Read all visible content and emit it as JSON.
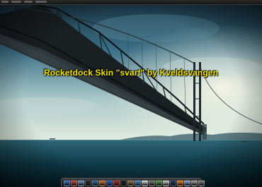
{
  "caption": "Rocketdock Skin \"svart\" by Kveldsvangen",
  "colors": {
    "caption": "#f2e600",
    "sky_top": "#1d3f52",
    "sky_horizon": "#d8e6df",
    "sea": "#0e3b48"
  },
  "dock": {
    "icons": [
      {
        "name": "finder-icon",
        "color": "#3c78d8"
      },
      {
        "name": "messenger-icon",
        "color": "#d04a4a"
      },
      {
        "name": "folder-icon",
        "color": "#6f9bd1"
      },
      {
        "name": "music-icon",
        "color": "#2a2a2a"
      },
      {
        "name": "dashboard-icon",
        "color": "#3b6fa6"
      },
      {
        "name": "firefox-icon",
        "color": "#e07a2c"
      },
      {
        "name": "globe-icon",
        "color": "#2f64c7"
      },
      {
        "name": "dictionary-icon",
        "color": "#b02e2e"
      },
      {
        "name": "terminal-icon",
        "color": "#1e1e1e"
      },
      {
        "name": "photo-icon",
        "color": "#9a7b4f"
      },
      {
        "name": "itunes-icon",
        "color": "#4f8fd6"
      },
      {
        "name": "calendar-icon",
        "color": "#e8e8e8"
      },
      {
        "name": "settings-icon",
        "color": "#7d7d7d"
      },
      {
        "name": "chat-icon",
        "color": "#5aa84a"
      },
      {
        "name": "clock-icon",
        "color": "#d9d9d9"
      },
      {
        "name": "photoshop-icon",
        "color": "#213a6b"
      },
      {
        "name": "vlc-icon",
        "color": "#f08a1c"
      },
      {
        "name": "mail-icon",
        "color": "#8fb4d9"
      },
      {
        "name": "disk-icon",
        "color": "#a9a9a9"
      },
      {
        "name": "trash-icon",
        "color": "#8a8a8a"
      }
    ]
  }
}
